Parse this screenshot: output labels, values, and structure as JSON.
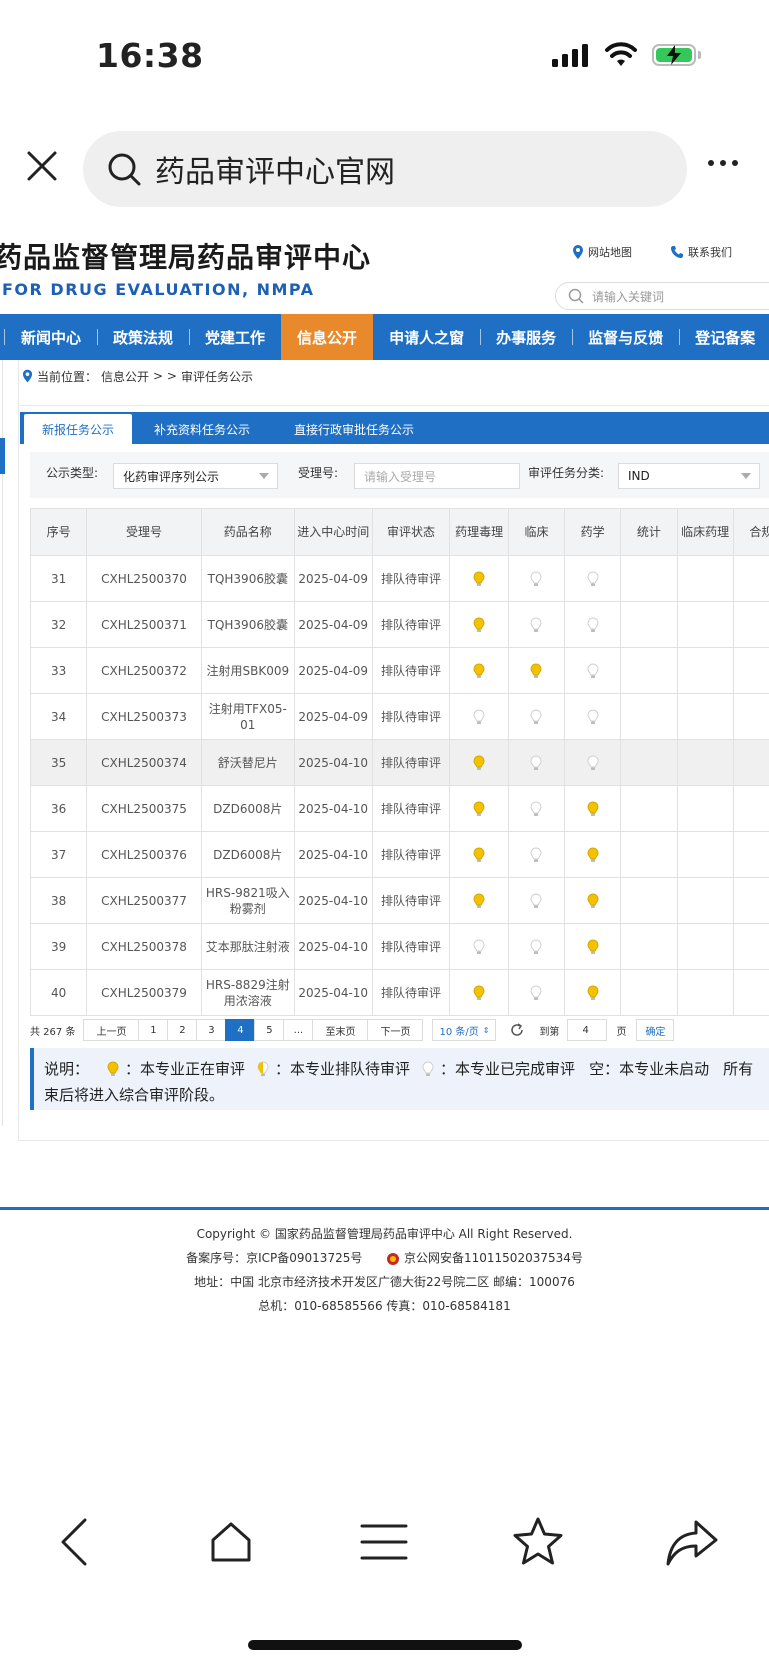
{
  "status_bar": {
    "time": "16:38"
  },
  "browser": {
    "search_text": "药品审评中心官网"
  },
  "site": {
    "title": "药品监督管理局药品审评中心",
    "subtitle": "FOR DRUG EVALUATION, NMPA",
    "sitemap_label": "网站地图",
    "contact_label": "联系我们",
    "search_placeholder": "请输入关键词",
    "nav": [
      "新闻中心",
      "政策法规",
      "党建工作",
      "信息公开",
      "申请人之窗",
      "办事服务",
      "监督与反馈",
      "登记备案"
    ],
    "nav_active": "信息公开",
    "breadcrumb": {
      "prefix": "当前位置：",
      "path1": "信息公开",
      "sep": "> >",
      "path2": "审评任务公示"
    },
    "tabs": [
      "新报任务公示",
      "补充资料任务公示",
      "直接行政审批任务公示"
    ],
    "filter": {
      "type_label": "公示类型:",
      "type_value": "化药审评序列公示",
      "acceptance_label": "受理号:",
      "acceptance_placeholder": "请输入受理号",
      "category_label": "审评任务分类:",
      "category_value": "IND"
    },
    "table": {
      "headers": [
        "序号",
        "受理号",
        "药品名称",
        "进入中心时间",
        "审评状态",
        "药理毒理",
        "临床",
        "药学",
        "统计",
        "临床药理",
        "合规"
      ],
      "rows": [
        {
          "no": "31",
          "id": "CXHL2500370",
          "name": "TQH3906胶囊",
          "date": "2025-04-09",
          "status": "排队待审评",
          "s": [
            "y",
            "w",
            "w"
          ]
        },
        {
          "no": "32",
          "id": "CXHL2500371",
          "name": "TQH3906胶囊",
          "date": "2025-04-09",
          "status": "排队待审评",
          "s": [
            "y",
            "w",
            "w"
          ]
        },
        {
          "no": "33",
          "id": "CXHL2500372",
          "name": "注射用SBK009",
          "date": "2025-04-09",
          "status": "排队待审评",
          "s": [
            "y",
            "y",
            "w"
          ]
        },
        {
          "no": "34",
          "id": "CXHL2500373",
          "name": "注射用TFX05-01",
          "date": "2025-04-09",
          "status": "排队待审评",
          "s": [
            "w",
            "w",
            "w"
          ]
        },
        {
          "no": "35",
          "id": "CXHL2500374",
          "name": "舒沃替尼片",
          "date": "2025-04-10",
          "status": "排队待审评",
          "s": [
            "y",
            "w",
            "w"
          ]
        },
        {
          "no": "36",
          "id": "CXHL2500375",
          "name": "DZD6008片",
          "date": "2025-04-10",
          "status": "排队待审评",
          "s": [
            "y",
            "w",
            "y"
          ]
        },
        {
          "no": "37",
          "id": "CXHL2500376",
          "name": "DZD6008片",
          "date": "2025-04-10",
          "status": "排队待审评",
          "s": [
            "y",
            "w",
            "y"
          ]
        },
        {
          "no": "38",
          "id": "CXHL2500377",
          "name": "HRS-9821吸入粉雾剂",
          "date": "2025-04-10",
          "status": "排队待审评",
          "s": [
            "y",
            "w",
            "y"
          ]
        },
        {
          "no": "39",
          "id": "CXHL2500378",
          "name": "艾本那肽注射液",
          "date": "2025-04-10",
          "status": "排队待审评",
          "s": [
            "w",
            "w",
            "y"
          ]
        },
        {
          "no": "40",
          "id": "CXHL2500379",
          "name": "HRS-8829注射用浓溶液",
          "date": "2025-04-10",
          "status": "排队待审评",
          "s": [
            "y",
            "w",
            "y"
          ]
        }
      ]
    },
    "pager": {
      "total": "共 267 条",
      "prev": "上一页",
      "pages": [
        "1",
        "2",
        "3",
        "4",
        "5",
        "..."
      ],
      "current": "4",
      "last": "至末页",
      "next": "下一页",
      "page_size": "10 条/页",
      "goto_label": "到第",
      "goto_value": "4",
      "page_unit": "页",
      "confirm": "确定"
    },
    "legend": {
      "label": "说明：",
      "reviewing": "：本专业正在审评",
      "queued": "：本专业排队待审评",
      "done": "：本专业已完成审评",
      "empty": "空：本专业未启动",
      "all_prefix": "所有",
      "line2": "束后将进入综合审评阶段。"
    },
    "footer": {
      "copyright": "Copyright © 国家药品监督管理局药品审评中心    All Right Reserved.",
      "icp": "备案序号：京ICP备09013725号",
      "police": "京公网安备11011502037534号",
      "address": "地址：中国 北京市经济技术开发区广德大街22号院二区      邮编：100076",
      "phone": "总机：010-68585566      传真：010-68584181"
    }
  },
  "colors": {
    "nav_blue": "#1f6fc4",
    "nav_active": "#e88a2c",
    "bulb_yellow": "#f2c200",
    "bulb_white": "#d0d0d0"
  }
}
